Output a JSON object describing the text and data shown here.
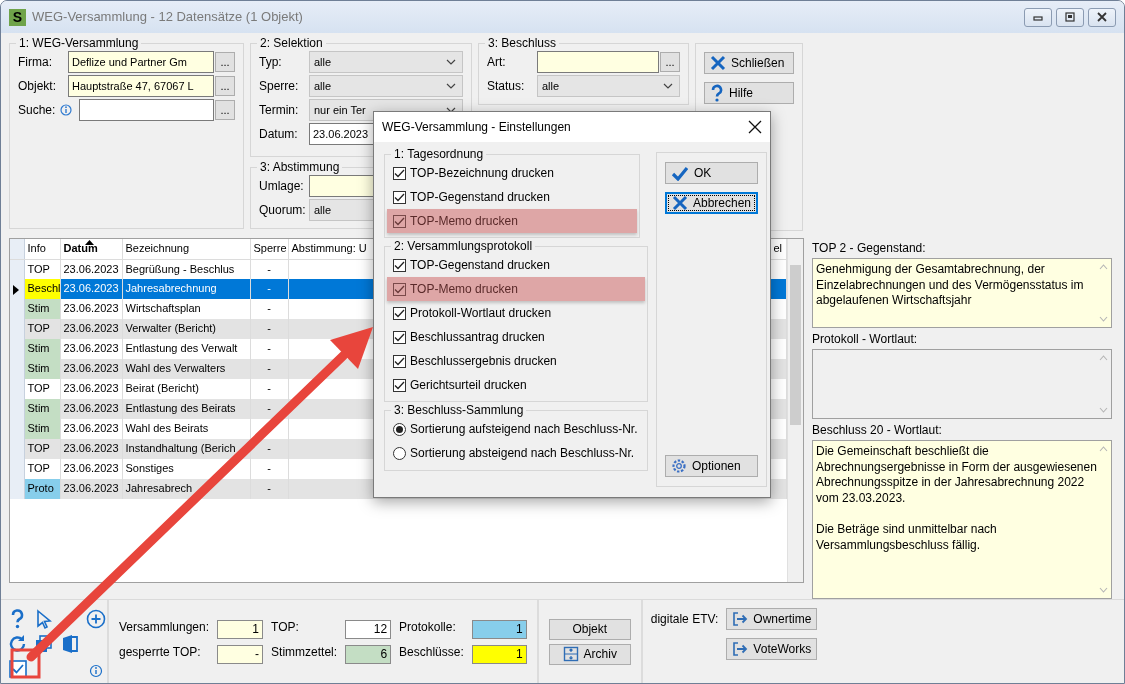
{
  "window": {
    "logo": "S",
    "title": "WEG-Versammlung - 12 Datensätze (1 Objekt)"
  },
  "groups": [
    {
      "title": "1: WEG-Versammlung",
      "fields": [
        {
          "label": "Firma:",
          "kind": "lookup",
          "value": "Deflize und Partner Gm",
          "mandatory": true,
          "button": "..."
        },
        {
          "label": "Objekt:",
          "kind": "lookup",
          "value": "Hauptstraße 47, 67067 L",
          "mandatory": true,
          "button": "..."
        },
        {
          "label": "Suche:",
          "kind": "lookup",
          "info": true,
          "mandatory": false,
          "button": "..."
        }
      ]
    },
    {
      "title": "2: Selektion",
      "fields": [
        {
          "label": "Typ:",
          "kind": "select",
          "value": "alle"
        },
        {
          "label": "Sperre:",
          "kind": "select",
          "value": "alle"
        },
        {
          "label": "Termin:",
          "kind": "select",
          "value": "nur ein Ter"
        },
        {
          "label": "Datum:",
          "kind": "date",
          "value": "23.06.2023"
        }
      ]
    },
    {
      "title": "3: Abstimmung",
      "fields": [
        {
          "label": "Umlage:",
          "kind": "lookup",
          "mandatory": true
        },
        {
          "label": "Quorum:",
          "kind": "select",
          "value": "alle"
        }
      ]
    },
    {
      "title": "3: Beschluss",
      "fields": [
        {
          "label": "Art:",
          "kind": "lookup",
          "mandatory": true,
          "button": "..."
        },
        {
          "label": "Status:",
          "kind": "select",
          "value": "alle"
        }
      ]
    }
  ],
  "actions": [
    {
      "label": "Schließen",
      "kind": "close"
    },
    {
      "label": "Hilfe",
      "kind": "help"
    }
  ],
  "table": {
    "columns": [
      {
        "label": "Info",
        "sorted": false
      },
      {
        "label": "Datum",
        "sorted": true
      },
      {
        "label": "Bezeichnung",
        "sorted": false
      },
      {
        "label": "Sperre",
        "sorted": false
      },
      {
        "label": "Abstimmung: U",
        "sorted": false
      },
      {
        "label": "el",
        "sorted": false
      }
    ],
    "rows": [
      {
        "info": "TOP",
        "datum": "23.06.2023",
        "bezeichnung": "Begrüßung - Beschlus",
        "sperre": "-",
        "selected": false
      },
      {
        "info": "Beschl",
        "color": "#ffff00",
        "datum": "23.06.2023",
        "bezeichnung": "Jahresabrechnung",
        "sperre": "-",
        "selected": true
      },
      {
        "info": "Stim",
        "color": "#c4dec4",
        "datum": "23.06.2023",
        "bezeichnung": "Wirtschaftsplan",
        "sperre": "-",
        "selected": false
      },
      {
        "info": "TOP",
        "datum": "23.06.2023",
        "bezeichnung": "Verwalter (Bericht)",
        "sperre": "-",
        "selected": false
      },
      {
        "info": "Stim",
        "color": "#c4dec4",
        "datum": "23.06.2023",
        "bezeichnung": "Entlastung des Verwalt",
        "sperre": "-",
        "selected": false
      },
      {
        "info": "Stim",
        "color": "#c4dec4",
        "datum": "23.06.2023",
        "bezeichnung": "Wahl des Verwalters",
        "sperre": "-",
        "selected": false
      },
      {
        "info": "TOP",
        "datum": "23.06.2023",
        "bezeichnung": "Beirat (Bericht)",
        "sperre": "-",
        "selected": false
      },
      {
        "info": "Stim",
        "color": "#c4dec4",
        "datum": "23.06.2023",
        "bezeichnung": "Entlastung des Beirats",
        "sperre": "-",
        "selected": false
      },
      {
        "info": "Stim",
        "color": "#c4dec4",
        "datum": "23.06.2023",
        "bezeichnung": "Wahl des Beirats",
        "selected": false
      },
      {
        "info": "TOP",
        "datum": "23.06.2023",
        "bezeichnung": "Instandhaltung (Berich",
        "sperre": "-",
        "selected": false
      },
      {
        "info": "TOP",
        "datum": "23.06.2023",
        "bezeichnung": "Sonstiges",
        "sperre": "-",
        "selected": false
      },
      {
        "info": "Proto",
        "color": "#87ceeb",
        "datum": "23.06.2023",
        "bezeichnung": "Jahresabrech",
        "sperre": "-",
        "selected": false
      }
    ]
  },
  "memos": [
    {
      "label": "TOP 2 - Gegenstand:",
      "text": "Genehmigung der Gesamtabrechnung, der Einzelabrechnungen und des Vermögensstatus im abgelaufenen Wirtschaftsjahr",
      "disabled": false
    },
    {
      "label": "Protokoll - Wortlaut:",
      "disabled": true
    },
    {
      "label": "Beschluss 20 - Wortlaut:",
      "text": "Die Gemeinschaft beschließt die Abrechnungsergebnisse in Form der ausgewiesenen Abrechnungsspitze in der Jahresabrechnung 2022 vom 23.03.2023.\n\nDie Beträge sind unmittelbar nach Versammlungsbeschluss fällig.",
      "disabled": false
    }
  ],
  "stats": [
    {
      "label": "Versammlungen:",
      "value": "1",
      "color": "#ffffe1"
    },
    {
      "label": "TOP:",
      "value": "12",
      "color": "#ffffff"
    },
    {
      "label": "Protokolle:",
      "value": "1",
      "color": "#87ceeb"
    },
    {
      "label": "gesperrte TOP:",
      "value": "-",
      "color": "#ffffe1"
    },
    {
      "label": "Stimmzettel:",
      "value": "6",
      "color": "#c4dec4"
    },
    {
      "label": "Beschlüsse:",
      "value": "1",
      "color": "#ffff00"
    }
  ],
  "object_buttons": [
    {
      "label": "Objekt",
      "kind": "plain"
    },
    {
      "label": "Archiv",
      "kind": "archive"
    }
  ],
  "etv": {
    "label": "digitale ETV:",
    "buttons": [
      {
        "label": "Ownertime"
      },
      {
        "label": "VoteWorks"
      }
    ]
  },
  "dialog": {
    "title": "WEG-Versammlung - Einstellungen",
    "groups": [
      {
        "title": "1: Tagesordnung",
        "kind": "checks",
        "options": [
          {
            "label": "TOP-Bezeichnung drucken",
            "checked": true,
            "highlighted": false
          },
          {
            "label": "TOP-Gegenstand drucken",
            "checked": true,
            "highlighted": false
          },
          {
            "label": "TOP-Memo drucken",
            "checked": true,
            "highlighted": true
          }
        ]
      },
      {
        "title": "2: Versammlungsprotokoll",
        "kind": "checks",
        "options": [
          {
            "label": "TOP-Gegenstand drucken",
            "checked": true,
            "highlighted": false
          },
          {
            "label": "TOP-Memo drucken",
            "checked": true,
            "highlighted": true
          },
          {
            "label": "Protokoll-Wortlaut drucken",
            "checked": true,
            "highlighted": false
          },
          {
            "label": "Beschlussantrag drucken",
            "checked": true,
            "highlighted": false
          },
          {
            "label": "Beschlussergebnis drucken",
            "checked": true,
            "highlighted": false
          },
          {
            "label": "Gerichtsurteil drucken",
            "checked": true,
            "highlighted": false
          }
        ]
      },
      {
        "title": "3: Beschluss-Sammlung",
        "kind": "radios",
        "options": [
          {
            "label": "Sortierung aufsteigend nach Beschluss-Nr.",
            "selected": true
          },
          {
            "label": "Sortierung absteigend nach Beschluss-Nr.",
            "selected": false
          }
        ]
      }
    ],
    "buttons": [
      {
        "label": "OK",
        "kind": "ok",
        "focused": false
      },
      {
        "label": "Abbrechen",
        "kind": "cancel",
        "focused": true
      },
      {
        "label": "Optionen",
        "kind": "options",
        "focused": false
      }
    ]
  }
}
